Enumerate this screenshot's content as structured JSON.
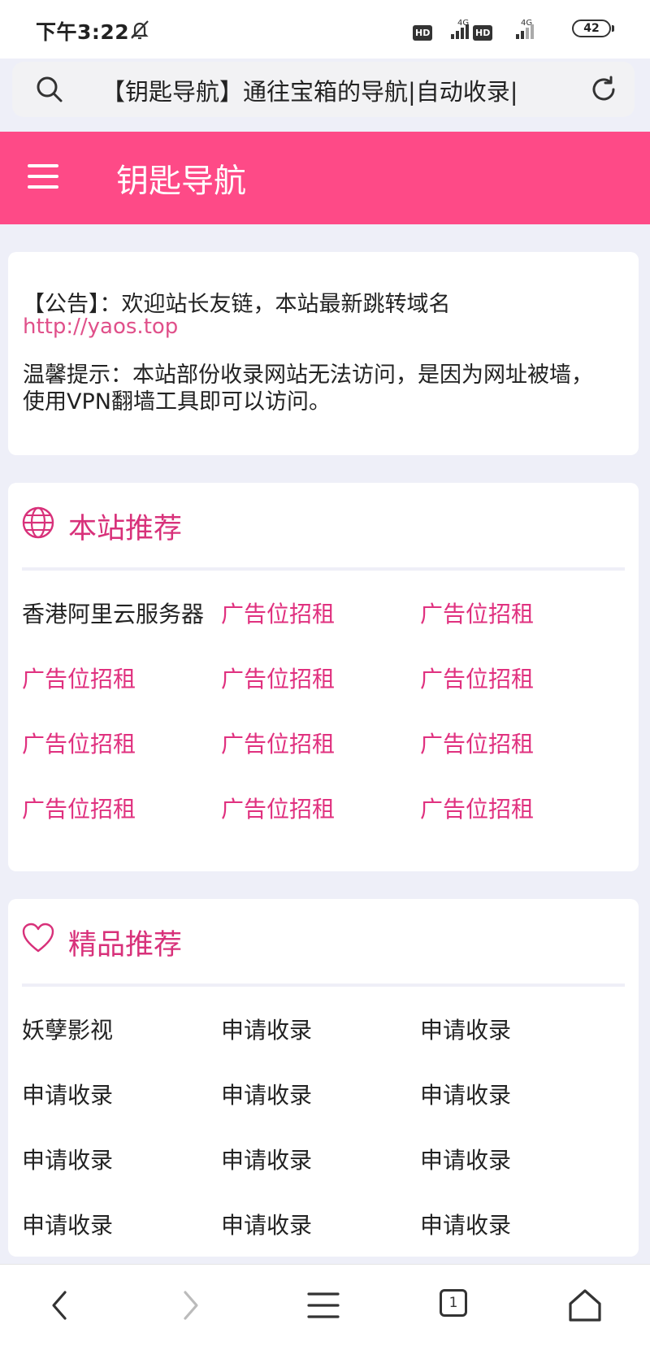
{
  "status_bar": {
    "time": "下午3:22",
    "network1": "4G",
    "network2": "4G",
    "hd1": "HD",
    "hd2": "HD",
    "battery": "42"
  },
  "url_bar": {
    "text": "【钥匙导航】通往宝箱的导航|自动收录|"
  },
  "header": {
    "title": "钥匙导航"
  },
  "notice": {
    "line1": "【公告】：欢迎站长友链，本站最新跳转域名",
    "link": "http://yaos.top",
    "tip": "温馨提示：本站部份收录网站无法访问，是因为网址被墙，使用VPN翻墙工具即可以访问。"
  },
  "section_recommend": {
    "title": "本站推荐",
    "items": [
      "香港阿里云服务器",
      "广告位招租",
      "广告位招租",
      "广告位招租",
      "广告位招租",
      "广告位招租",
      "广告位招租",
      "广告位招租",
      "广告位招租",
      "广告位招租",
      "广告位招租",
      "广告位招租"
    ]
  },
  "section_premium": {
    "title": "精品推荐",
    "items": [
      "妖孽影视",
      "申请收录",
      "申请收录",
      "申请收录",
      "申请收录",
      "申请收录",
      "申请收录",
      "申请收录",
      "申请收录",
      "申请收录",
      "申请收录",
      "申请收录"
    ]
  },
  "bottom_nav": {
    "tab_count": "1"
  },
  "colors": {
    "brand": "#fe4a87",
    "link": "#e0317f",
    "section_title": "#d8317a",
    "page_bg": "#eeeff8"
  }
}
